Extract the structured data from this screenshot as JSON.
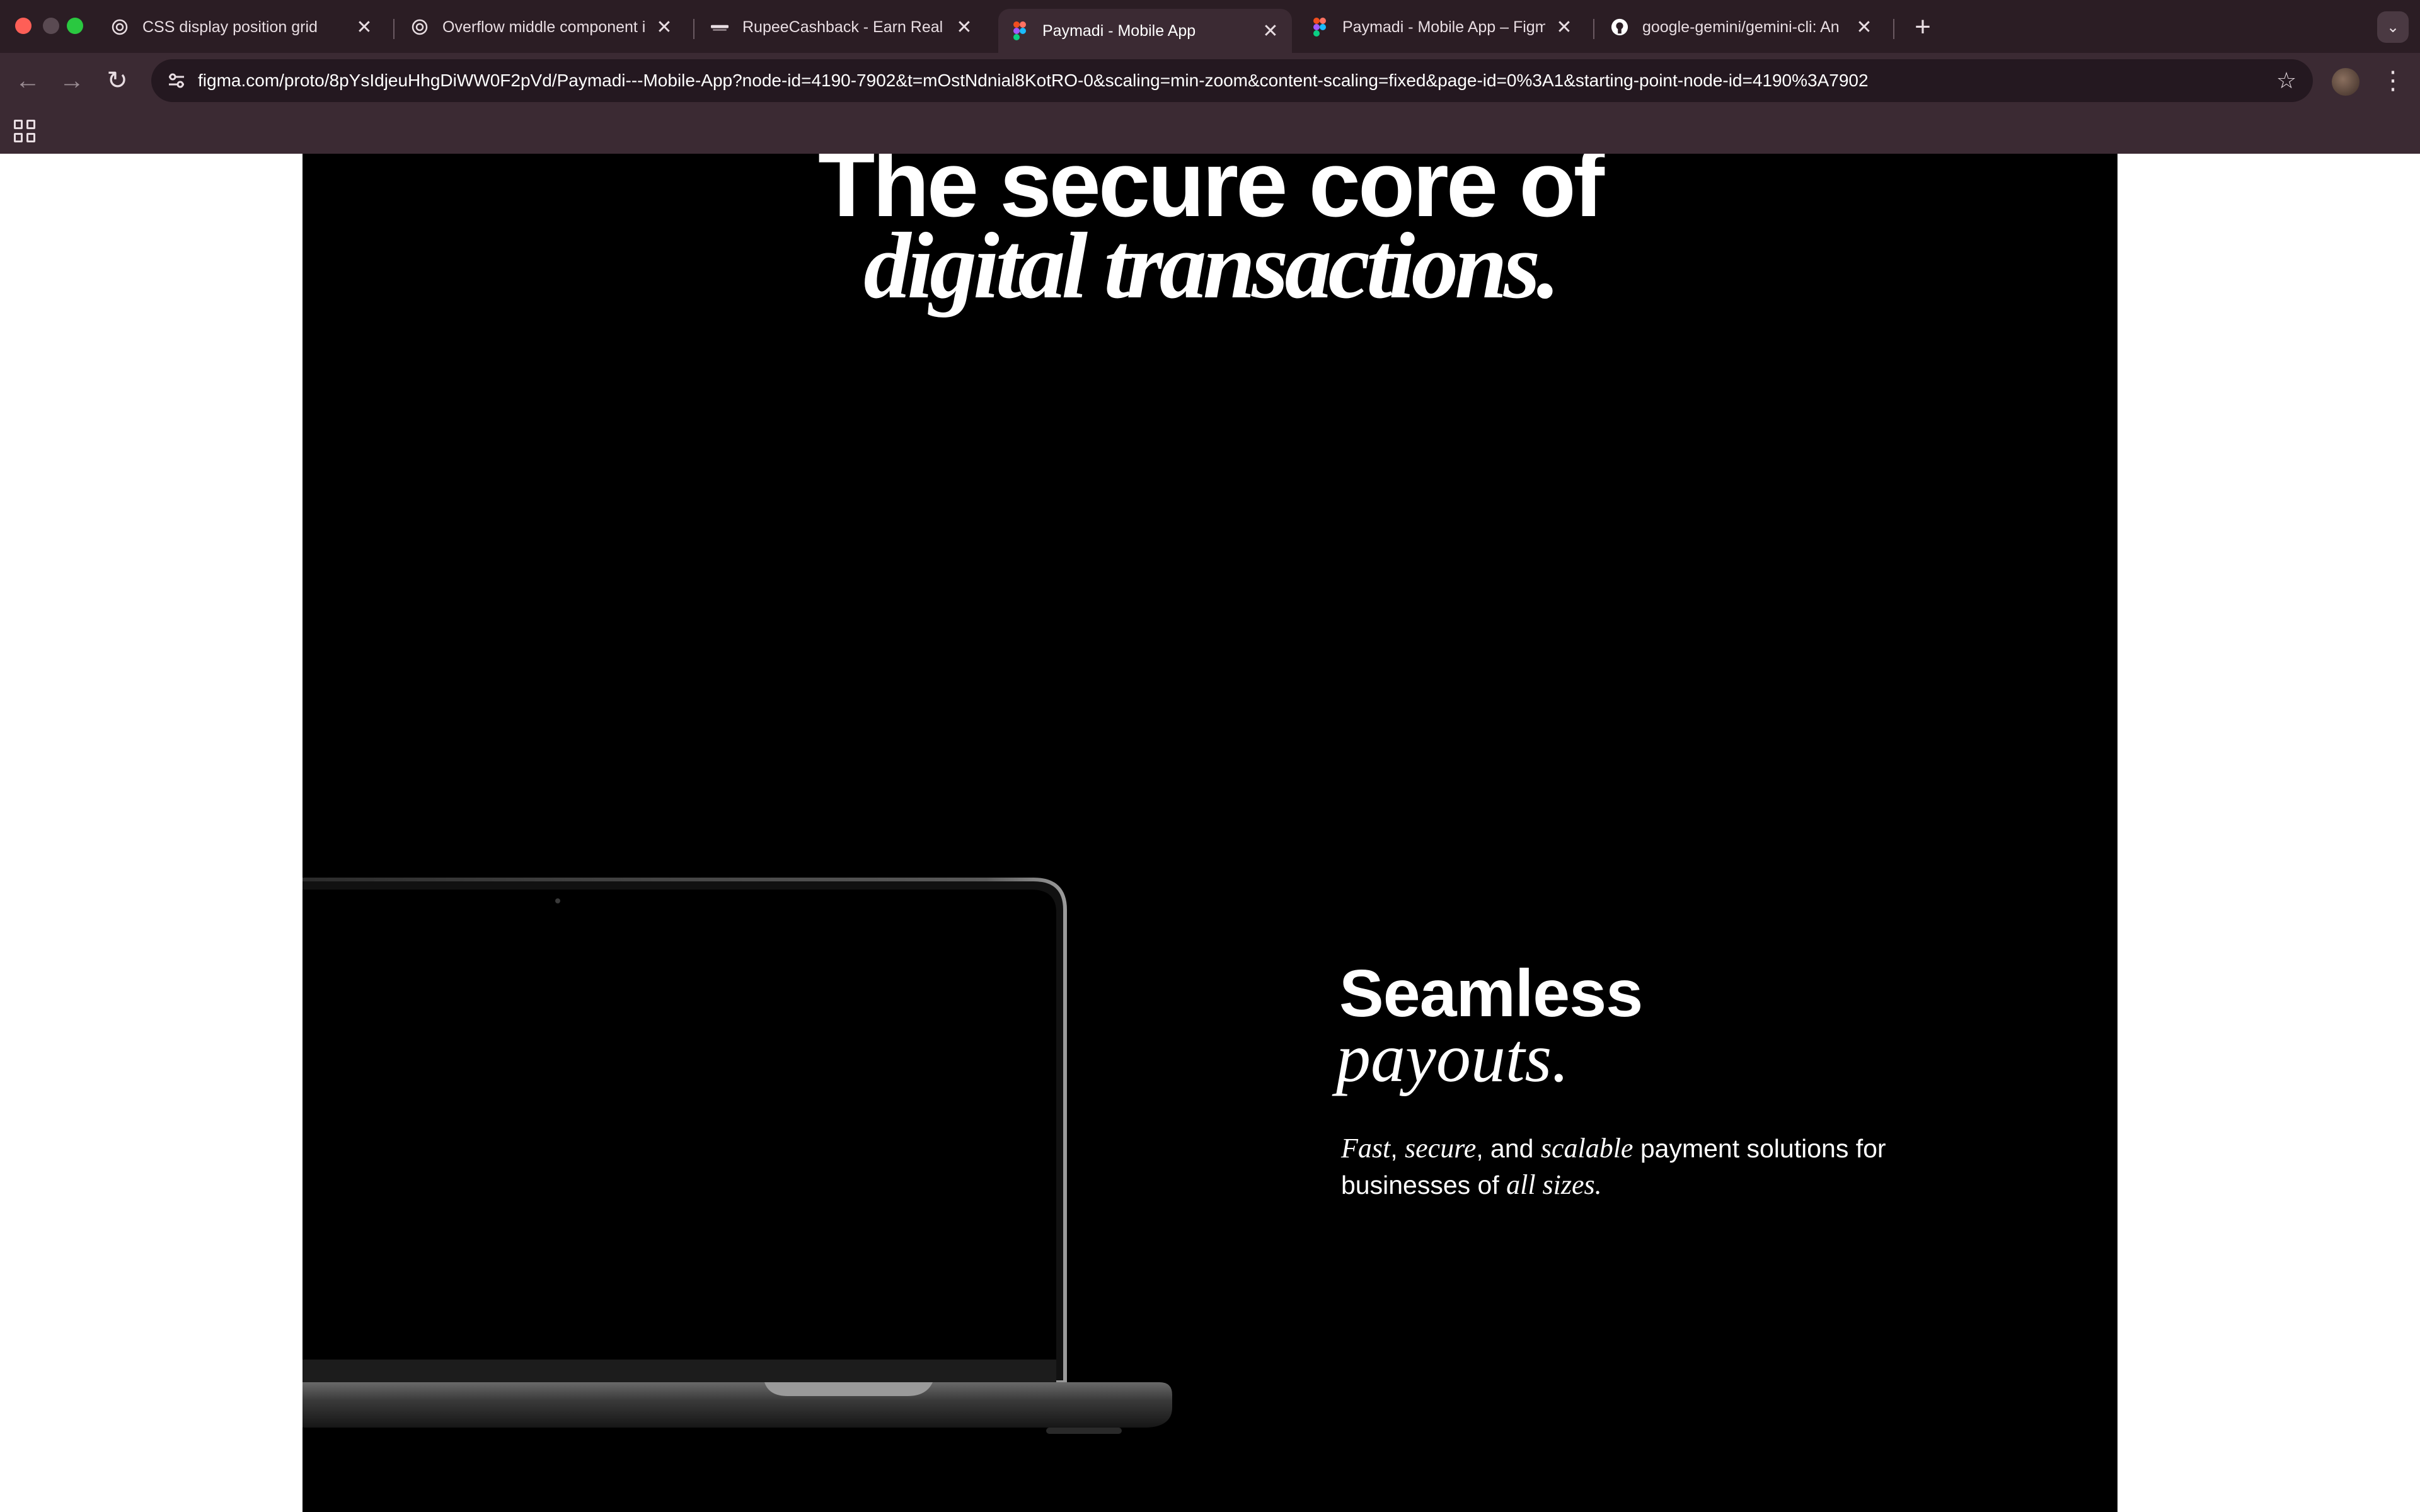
{
  "browser": {
    "tabs": [
      {
        "title": "CSS display position grid",
        "icon": "chatgpt-icon",
        "active": false
      },
      {
        "title": "Overflow middle component i",
        "icon": "chatgpt-icon",
        "active": false
      },
      {
        "title": "RupeeCashback - Earn Real M",
        "icon": "rupeecashback-icon",
        "active": false
      },
      {
        "title": "Paymadi - Mobile App",
        "icon": "figma-icon",
        "active": true
      },
      {
        "title": "Paymadi - Mobile App – Figm",
        "icon": "figma-icon",
        "active": false
      },
      {
        "title": "google-gemini/gemini-cli: An",
        "icon": "github-icon",
        "active": false
      }
    ],
    "close_glyph": "✕",
    "new_tab_glyph": "+",
    "url": "figma.com/proto/8pYsIdjeuHhgDiWW0F2pVd/Paymadi---Mobile-App?node-id=4190-7902&t=mOstNdnial8KotRO-0&scaling=min-zoom&content-scaling=fixed&page-id=0%3A1&starting-point-node-id=4190%3A7902"
  },
  "hero": {
    "line1": "The secure core of",
    "line2": "digital transactions."
  },
  "feature": {
    "title": "Seamless",
    "title_italic": "payouts.",
    "desc_parts": {
      "fast": "Fast",
      "sep1": ", ",
      "secure": "secure",
      "sep2": ", and ",
      "scalable": "scalable",
      "sep3": " payment solutions for businesses of ",
      "all_sizes": "all sizes."
    }
  },
  "colors": {
    "frame_bg": "#000000",
    "chrome_bg": "#3b2a33",
    "tabstrip_bg": "#2b1d24",
    "text": "#ffffff"
  }
}
